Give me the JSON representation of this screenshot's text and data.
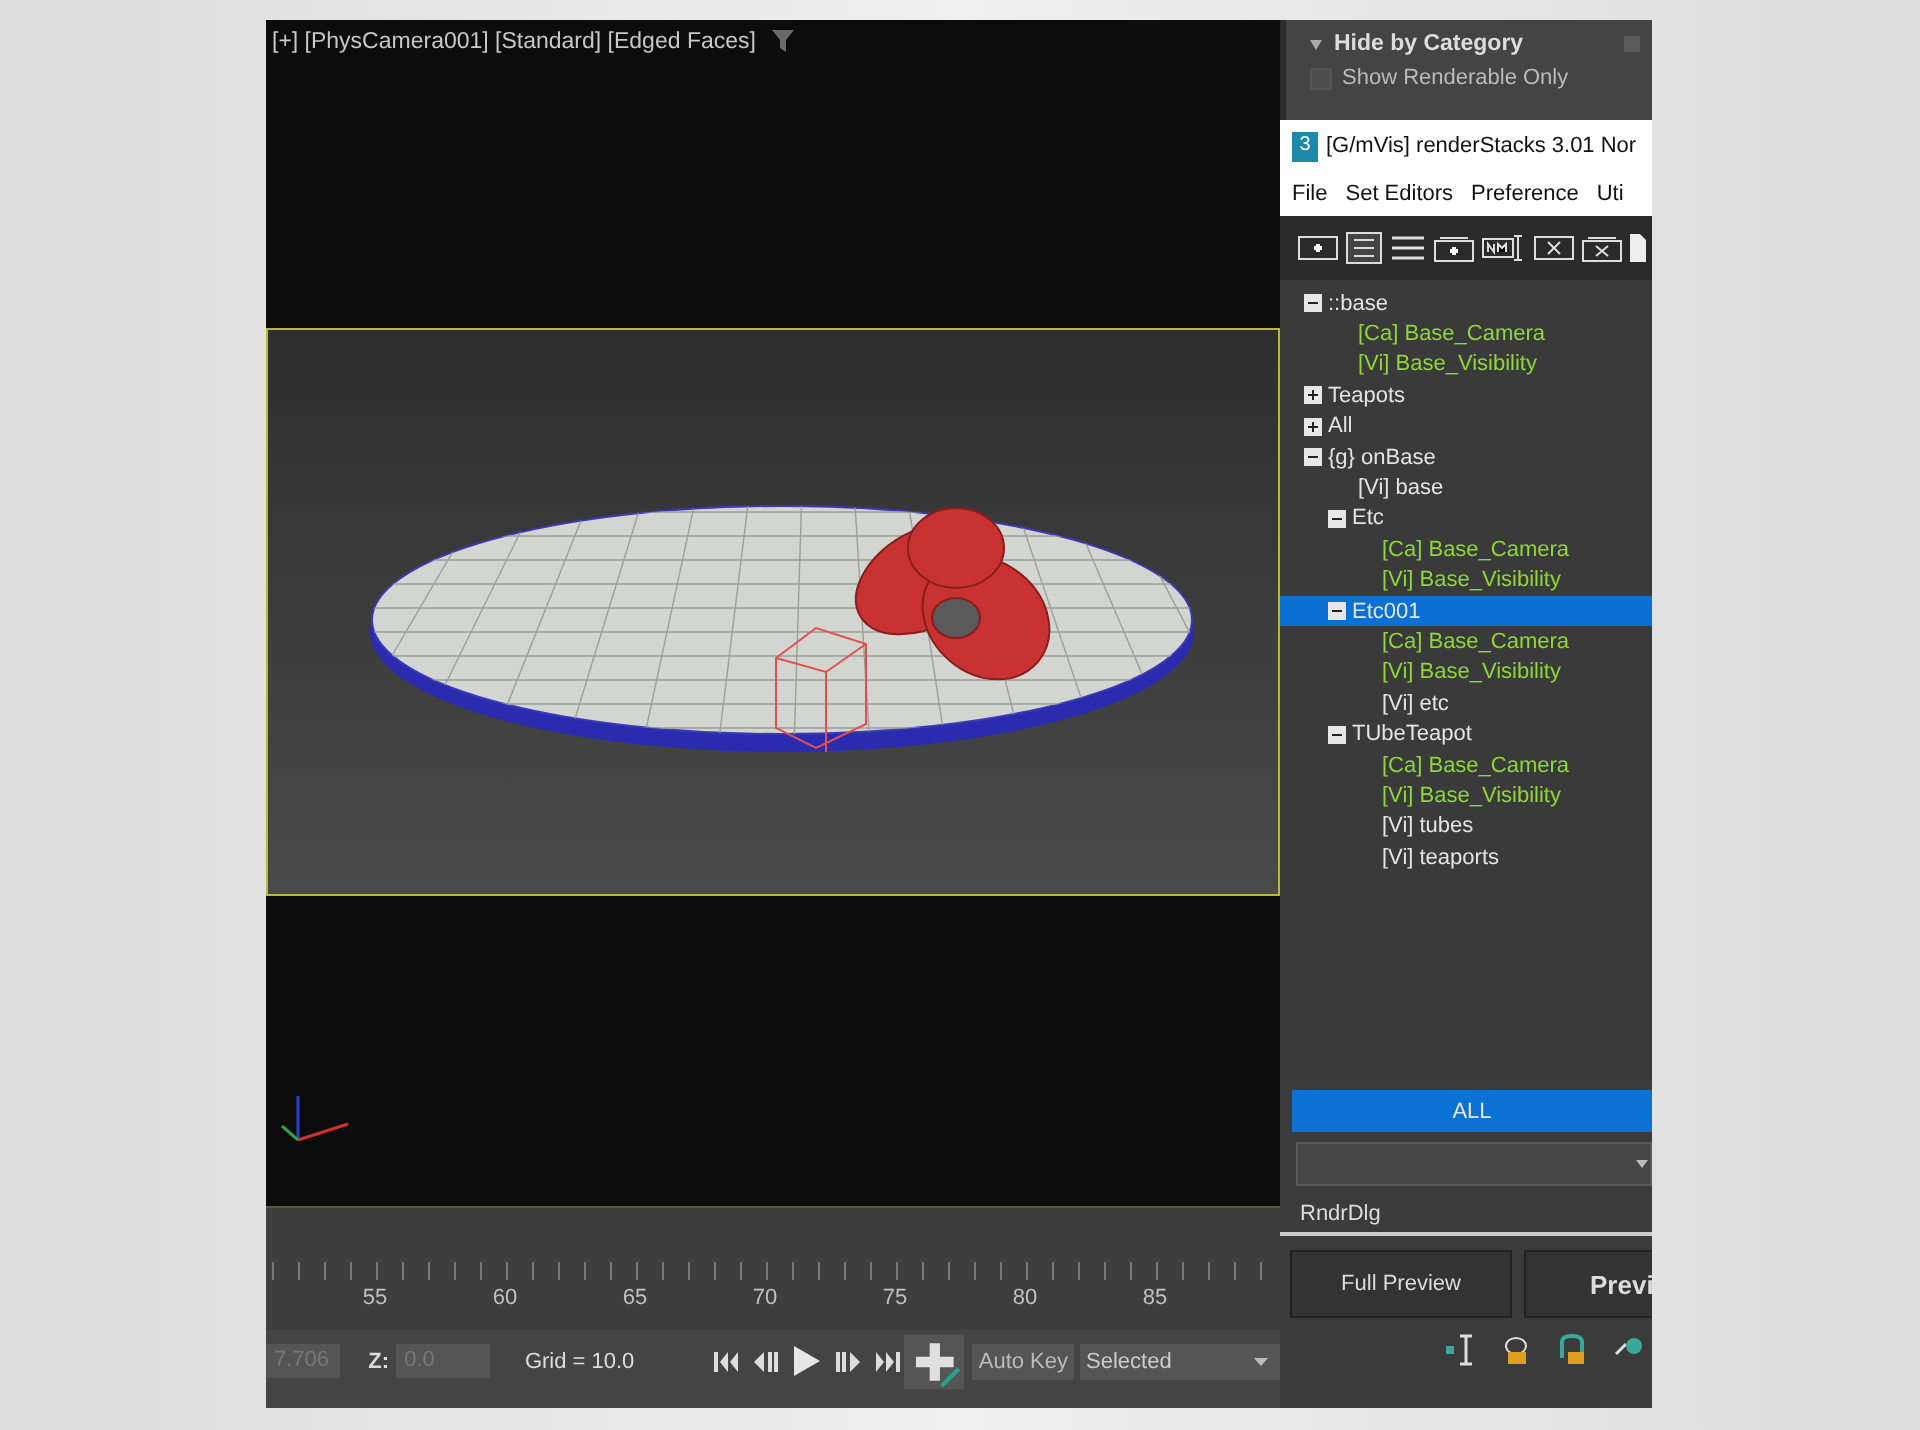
{
  "viewport": {
    "label": "[+] [PhysCamera001] [Standard] [Edged Faces]"
  },
  "timeline": {
    "frame_labels": [
      "55",
      "60",
      "65",
      "70",
      "75",
      "80",
      "85"
    ]
  },
  "status_bar": {
    "x_value": "7.706",
    "z_label": "Z:",
    "z_value": "0.0",
    "grid": "Grid = 10.0",
    "auto_key": "Auto Key",
    "selection": "Selected"
  },
  "rollout": {
    "title": "Hide by Category",
    "show_renderable_only": {
      "label": "Show Renderable Only",
      "checked": false
    }
  },
  "window": {
    "icon_label": "3",
    "title": "[G/mVis] renderStacks 3.01 Nor"
  },
  "menu": [
    "File",
    "Set Editors",
    "Preference",
    "Uti"
  ],
  "tree": {
    "items": [
      {
        "label": "::base",
        "kind": "group",
        "expanded": true,
        "selected": false,
        "children": [
          {
            "label": "[Ca] Base_Camera",
            "kind": "inherited",
            "selected": false
          },
          {
            "label": "[Vi] Base_Visibility",
            "kind": "inherited",
            "selected": false
          }
        ]
      },
      {
        "label": "Teapots",
        "kind": "group",
        "expanded": false,
        "selected": false
      },
      {
        "label": "All",
        "kind": "group",
        "expanded": false,
        "selected": false
      },
      {
        "label": "{g} onBase",
        "kind": "group",
        "expanded": true,
        "selected": false,
        "children": [
          {
            "label": "[Vi] base",
            "kind": "local",
            "selected": false
          },
          {
            "label": "Etc",
            "kind": "group",
            "expanded": true,
            "selected": false,
            "children": [
              {
                "label": "[Ca] Base_Camera",
                "kind": "inherited",
                "selected": false
              },
              {
                "label": "[Vi] Base_Visibility",
                "kind": "inherited",
                "selected": false
              }
            ]
          },
          {
            "label": "Etc001",
            "kind": "group",
            "expanded": true,
            "selected": true,
            "children": [
              {
                "label": "[Ca] Base_Camera",
                "kind": "inherited",
                "selected": false
              },
              {
                "label": "[Vi] Base_Visibility",
                "kind": "inherited",
                "selected": false
              },
              {
                "label": "[Vi] etc",
                "kind": "local",
                "selected": false
              }
            ]
          },
          {
            "label": "TUbeTeapot",
            "kind": "group",
            "expanded": true,
            "selected": false,
            "children": [
              {
                "label": "[Ca] Base_Camera",
                "kind": "inherited",
                "selected": false
              },
              {
                "label": "[Vi] Base_Visibility",
                "kind": "inherited",
                "selected": false
              },
              {
                "label": "[Vi] tubes",
                "kind": "local",
                "selected": false
              },
              {
                "label": "[Vi] teaports",
                "kind": "local",
                "selected": false
              }
            ]
          }
        ]
      }
    ]
  },
  "filter_button": {
    "label": "ALL",
    "active": true
  },
  "stack_label": "RndrDlg",
  "buttons": [
    {
      "label": "Full Preview",
      "kind": "normal"
    },
    {
      "label": "Previ",
      "kind": "primary"
    }
  ]
}
